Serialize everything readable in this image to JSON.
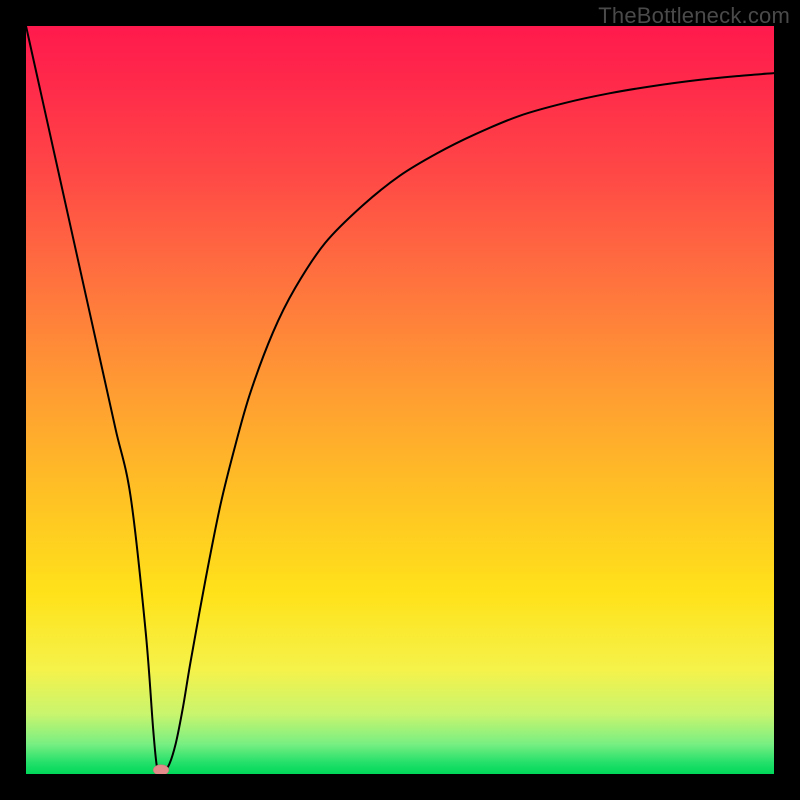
{
  "watermark": "TheBottleneck.com",
  "colors": {
    "frame": "#000000",
    "curve_stroke": "#000000",
    "dot_fill": "#e38a8a"
  },
  "chart_data": {
    "type": "line",
    "title": "",
    "xlabel": "",
    "ylabel": "",
    "xlim": [
      0,
      100
    ],
    "ylim": [
      0,
      100
    ],
    "grid": false,
    "legend": false,
    "series": [
      {
        "name": "bottleneck-curve",
        "x": [
          0,
          2,
          4,
          6,
          8,
          10,
          12,
          14,
          16,
          17,
          17.5,
          18,
          19,
          20,
          21,
          22,
          24,
          26,
          28,
          30,
          33,
          36,
          40,
          45,
          50,
          55,
          60,
          66,
          72,
          78,
          84,
          90,
          95,
          100
        ],
        "values": [
          100,
          91,
          82,
          73,
          64,
          55,
          46,
          37,
          19,
          6,
          1,
          0.5,
          1,
          4,
          9,
          15,
          26,
          36,
          44,
          51,
          59,
          65,
          71,
          76,
          80,
          83,
          85.5,
          88,
          89.7,
          91,
          92,
          92.8,
          93.3,
          93.7
        ]
      }
    ],
    "marker": {
      "x": 18,
      "y": 0.5
    },
    "background_gradient_stops": [
      {
        "pct": 0,
        "color": "#ff1a4d"
      },
      {
        "pct": 8,
        "color": "#ff2a4a"
      },
      {
        "pct": 20,
        "color": "#ff4946"
      },
      {
        "pct": 33,
        "color": "#ff6f3f"
      },
      {
        "pct": 48,
        "color": "#ff9a33"
      },
      {
        "pct": 63,
        "color": "#ffc224"
      },
      {
        "pct": 76,
        "color": "#ffe21a"
      },
      {
        "pct": 86,
        "color": "#f5f24a"
      },
      {
        "pct": 92,
        "color": "#c9f56e"
      },
      {
        "pct": 96,
        "color": "#78ef82"
      },
      {
        "pct": 98.5,
        "color": "#23e06a"
      },
      {
        "pct": 100,
        "color": "#00d85a"
      }
    ]
  }
}
